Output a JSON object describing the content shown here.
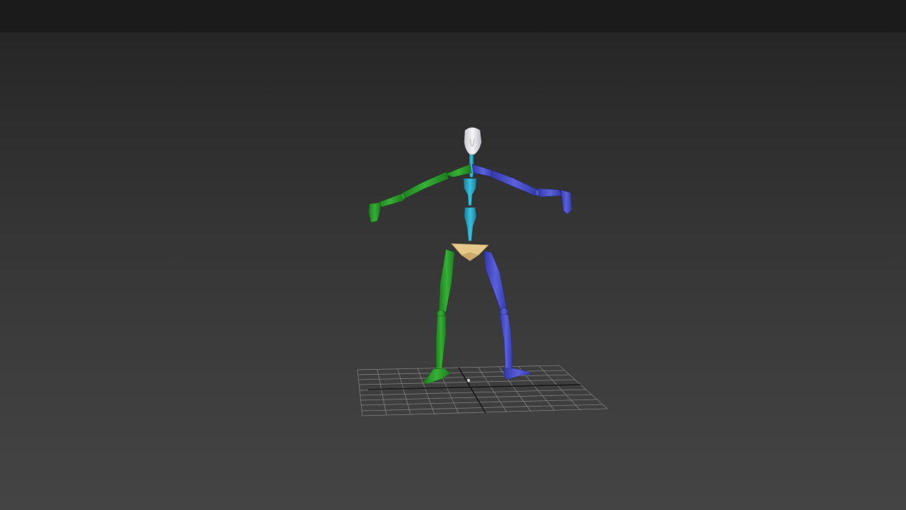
{
  "viewport": {
    "background_top": "#1c1c1c",
    "background_bottom": "#444444"
  },
  "colors": {
    "left_side": "#2f9a2f",
    "right_side": "#4a4fc6",
    "spine": "#2aa6c6",
    "pelvis": "#e6c98a",
    "head": "#e8e8ec",
    "grid": "#8a8a8a"
  },
  "scene": {
    "object": "biped-skeleton",
    "icons": [
      "grid-floor-icon"
    ]
  }
}
